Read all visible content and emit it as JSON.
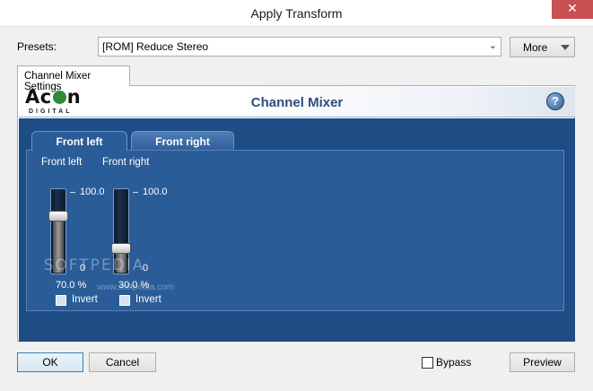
{
  "window": {
    "title": "Apply Transform",
    "close_glyph": "✕"
  },
  "presets": {
    "label": "Presets:",
    "value": "[ROM] Reduce Stereo",
    "more_label": "More"
  },
  "outer_tab": {
    "label": "Channel Mixer Settings"
  },
  "header": {
    "logo_big_a": "Ac",
    "logo_big_b": "n",
    "logo_small": "DIGITAL",
    "title": "Channel Mixer",
    "help_glyph": "?"
  },
  "tabs": [
    {
      "label": "Front left",
      "active": true
    },
    {
      "label": "Front right",
      "active": false
    }
  ],
  "channels": [
    {
      "label": "Front left",
      "value_text": "70.0 %",
      "level": 0.7,
      "invert_label": "Invert"
    },
    {
      "label": "Front right",
      "value_text": "30.0 %",
      "level": 0.3,
      "invert_label": "Invert"
    }
  ],
  "scale": {
    "max_label": "100.0",
    "min_label": "0"
  },
  "watermark": {
    "big": "SOFTPEDIA",
    "small": "www.softpedia.com"
  },
  "footer": {
    "ok_label": "OK",
    "cancel_label": "Cancel",
    "bypass_label": "Bypass",
    "preview_label": "Preview"
  },
  "colors": {
    "panel_blue": "#1e4d86",
    "header_text": "#2d4f7c",
    "logo_green": "#2d8c3a",
    "close_red": "#c75050"
  }
}
